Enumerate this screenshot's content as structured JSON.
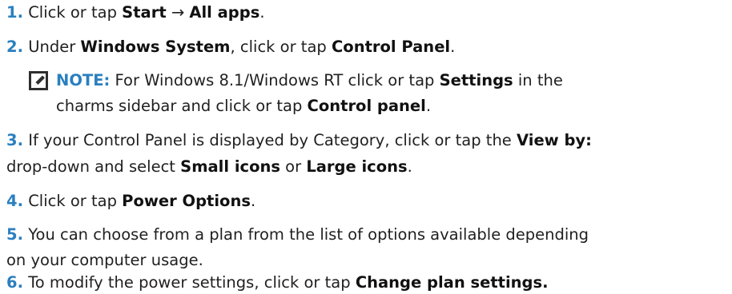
{
  "steps": [
    {
      "num": "1.",
      "parts": [
        "Click or tap ",
        "Start",
        " → ",
        "All apps",
        "."
      ]
    },
    {
      "num": "2.",
      "parts": [
        "Under ",
        "Windows System",
        ", click or tap ",
        "Control Panel",
        "."
      ]
    },
    {
      "num": "3.",
      "parts": [
        "If your Control Panel is displayed by Category, click or tap the ",
        "View by:",
        "drop-down and select ",
        "Small icons",
        " or ",
        "Large icons",
        "."
      ]
    },
    {
      "num": "4.",
      "parts": [
        "Click or tap ",
        "Power Options",
        "."
      ]
    },
    {
      "num": "5.",
      "parts": [
        "You can choose from a plan from the list of options available depending",
        "on your computer usage."
      ]
    },
    {
      "num": "6.",
      "parts": [
        "To modify the power settings, click or tap ",
        "Change plan settings."
      ]
    }
  ],
  "note": {
    "icon": "pencil-note-icon",
    "label": "NOTE:",
    "parts": [
      " For Windows 8.1/Windows RT click or tap ",
      "Settings",
      " in the",
      "charms sidebar and click or tap ",
      "Control panel",
      "."
    ]
  },
  "colors": {
    "accent": "#2a7fbf",
    "text": "#1f1f1f"
  }
}
